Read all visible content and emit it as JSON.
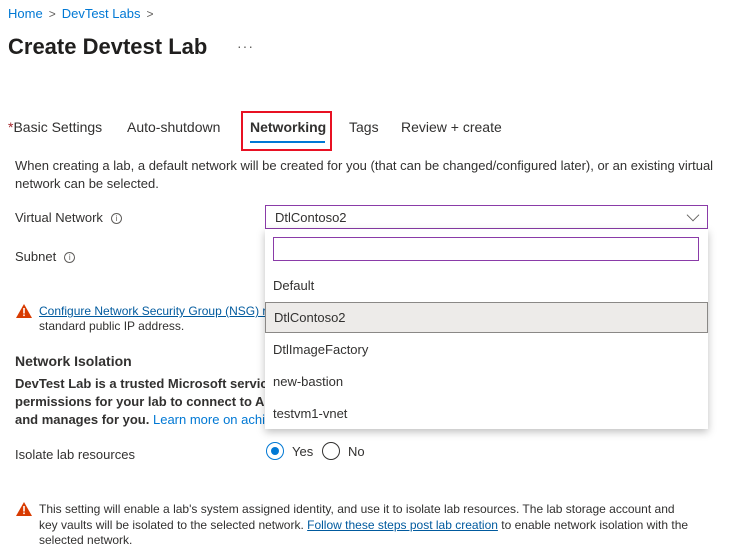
{
  "breadcrumb": {
    "items": [
      "Home",
      "DevTest Labs"
    ]
  },
  "page": {
    "title": "Create Devtest Lab",
    "more": "···"
  },
  "tabs": [
    {
      "label": "Basic Settings",
      "required": "*"
    },
    {
      "label": "Auto-shutdown"
    },
    {
      "label": "Networking",
      "active": true
    },
    {
      "label": "Tags"
    },
    {
      "label": "Review + create"
    }
  ],
  "networking": {
    "description": "When creating a lab, a default network will be created for you (that can be changed/configured later), or an existing virtual network can be selected.",
    "virtual_network_label": "Virtual Network",
    "virtual_network_value": "DtlContoso2",
    "subnet_label": "Subnet",
    "search_value": "",
    "options": [
      "Default",
      "DtlContoso2",
      "DtlImageFactory",
      "new-bastion",
      "testvm1-vnet"
    ],
    "nsg_warning_link": "Configure Network Security Group (NSG) r",
    "nsg_warning_line2": "standard public IP address.",
    "isolation_heading": "Network Isolation",
    "isolation_line1": "DevTest Lab is a trusted Microsoft service w",
    "isolation_line2": "permissions for your lab to connect to Azu",
    "isolation_line3": "and manages for you. ",
    "isolation_link": "Learn more on achie",
    "isolate_label": "Isolate lab resources",
    "isolate_yes": "Yes",
    "isolate_no": "No",
    "bottom_warning_1": "This setting will enable a lab's system assigned identity, and use it to isolate lab resources. The lab storage account and key vaults will be isolated to the selected network. ",
    "bottom_warning_link": "Follow these steps post lab creation",
    "bottom_warning_2": " to enable network isolation with the selected network."
  },
  "colors": {
    "accent": "#0078d4",
    "focus": "#8a3ba8",
    "warning": "#d83b01",
    "highlight": "#e81123"
  }
}
